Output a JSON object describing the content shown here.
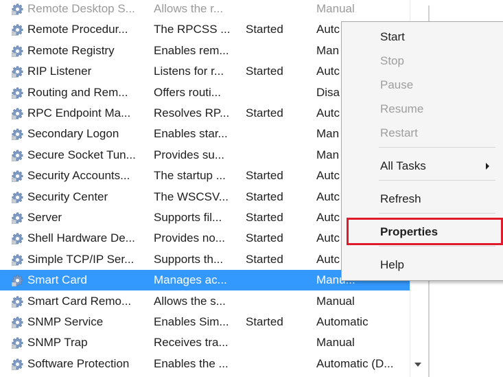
{
  "services": [
    {
      "name": "Remote Desktop S...",
      "description": "Allows the r...",
      "status": "",
      "startup": "Manual",
      "partial": true
    },
    {
      "name": "Remote Procedur...",
      "description": "The RPCSS ...",
      "status": "Started",
      "startup": "Autc"
    },
    {
      "name": "Remote Registry",
      "description": "Enables rem...",
      "status": "",
      "startup": "Man"
    },
    {
      "name": "RIP Listener",
      "description": "Listens for r...",
      "status": "Started",
      "startup": "Autc"
    },
    {
      "name": "Routing and Rem...",
      "description": "Offers routi...",
      "status": "",
      "startup": "Disa"
    },
    {
      "name": "RPC Endpoint Ma...",
      "description": "Resolves RP...",
      "status": "Started",
      "startup": "Autc"
    },
    {
      "name": "Secondary Logon",
      "description": "Enables star...",
      "status": "",
      "startup": "Man"
    },
    {
      "name": "Secure Socket Tun...",
      "description": "Provides su...",
      "status": "",
      "startup": "Man"
    },
    {
      "name": "Security Accounts...",
      "description": "The startup ...",
      "status": "Started",
      "startup": "Autc"
    },
    {
      "name": "Security Center",
      "description": "The WSCSV...",
      "status": "Started",
      "startup": "Autc"
    },
    {
      "name": "Server",
      "description": "Supports fil...",
      "status": "Started",
      "startup": "Autc"
    },
    {
      "name": "Shell Hardware De...",
      "description": "Provides no...",
      "status": "Started",
      "startup": "Autc"
    },
    {
      "name": "Simple TCP/IP Ser...",
      "description": "Supports th...",
      "status": "Started",
      "startup": "Autc"
    },
    {
      "name": "Smart Card",
      "description": "Manages ac...",
      "status": "",
      "startup": "Manu...",
      "selected": true
    },
    {
      "name": "Smart Card Remo...",
      "description": "Allows the s...",
      "status": "",
      "startup": "Manual"
    },
    {
      "name": "SNMP Service",
      "description": "Enables Sim...",
      "status": "Started",
      "startup": "Automatic"
    },
    {
      "name": "SNMP Trap",
      "description": "Receives tra...",
      "status": "",
      "startup": "Manual"
    },
    {
      "name": "Software Protection",
      "description": "Enables the ...",
      "status": "",
      "startup": "Automatic (D..."
    }
  ],
  "context_menu": {
    "items": [
      {
        "label": "Start",
        "enabled": true
      },
      {
        "label": "Stop",
        "enabled": false
      },
      {
        "label": "Pause",
        "enabled": false
      },
      {
        "label": "Resume",
        "enabled": false
      },
      {
        "label": "Restart",
        "enabled": false
      },
      {
        "label": "All Tasks",
        "enabled": true,
        "submenu": true
      },
      {
        "label": "Refresh",
        "enabled": true
      },
      {
        "label": "Properties",
        "enabled": true,
        "bold": true,
        "highlighted": true
      },
      {
        "label": "Help",
        "enabled": true
      }
    ]
  },
  "icons": {
    "service": "gear-icon",
    "submenu": "chevron-right-icon",
    "scroll_down": "scroll-down-arrow-icon"
  },
  "colors": {
    "selection": "#3399ff",
    "highlight_box": "#e0192b",
    "disabled_text": "#9e9e9e"
  }
}
